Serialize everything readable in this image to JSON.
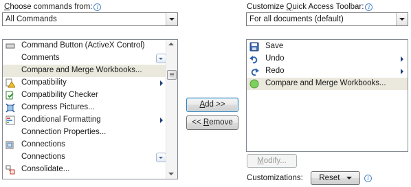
{
  "left": {
    "label_prefix": "",
    "label_access_key": "C",
    "label_rest": "hoose commands from:",
    "combo_value": "All Commands",
    "items": [
      {
        "label": "Command Button (ActiveX Control)",
        "icon": "command-button-icon"
      },
      {
        "label": "Comments",
        "icon": "none",
        "has_dropdown": true
      },
      {
        "label": "Compare and Merge Workbooks...",
        "icon": "none",
        "selected": true
      },
      {
        "label": "Compatibility",
        "icon": "compatibility-warning-icon",
        "has_submenu": true
      },
      {
        "label": "Compatibility Checker",
        "icon": "compatibility-checker-icon"
      },
      {
        "label": "Compress Pictures...",
        "icon": "compress-pictures-icon"
      },
      {
        "label": "Conditional Formatting",
        "icon": "conditional-formatting-icon",
        "has_submenu": true
      },
      {
        "label": "Connection Properties...",
        "icon": "none"
      },
      {
        "label": "Connections",
        "icon": "connections-icon"
      },
      {
        "label": "Connections",
        "icon": "none",
        "has_dropdown": true
      },
      {
        "label": "Consolidate...",
        "icon": "consolidate-icon"
      }
    ]
  },
  "buttons": {
    "add": "Add >>",
    "add_access_key": "A",
    "remove_prefix": "<< ",
    "remove_access_key": "R",
    "remove_rest": "emove",
    "modify_access_key": "M",
    "modify_rest": "odify...",
    "reset": "Reset"
  },
  "right": {
    "label_before": "Customize ",
    "label_access_key": "Q",
    "label_rest": "uick Access Toolbar:",
    "combo_value": "For all documents (default)",
    "items": [
      {
        "label": "Save",
        "icon": "save-icon"
      },
      {
        "label": "Undo",
        "icon": "undo-icon",
        "has_submenu": true
      },
      {
        "label": "Redo",
        "icon": "redo-icon",
        "has_submenu": true
      },
      {
        "label": "Compare and Merge Workbooks...",
        "icon": "green-circle-icon",
        "selected": true
      }
    ],
    "customizations_label": "Customizations:"
  },
  "colors": {
    "selection": "#ebe9dd",
    "info_blue": "#2f6fb8"
  }
}
